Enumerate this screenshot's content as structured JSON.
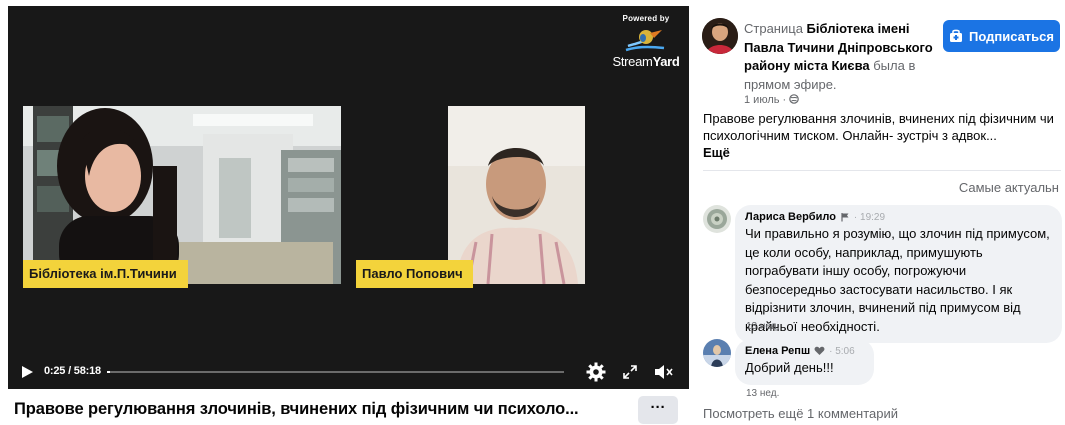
{
  "video": {
    "powered_by": "Powered by",
    "brand_light": "Stream",
    "brand_bold": "Yard",
    "participants": [
      {
        "name": "Бібліотека ім.П.Тичини"
      },
      {
        "name": "Павло Попович"
      }
    ],
    "time": "0:25 / 58:18",
    "progress_fraction": 0.007,
    "title": "Правове регулювання злочинів, вчинених під фізичним чи психоло...",
    "more_label": "···"
  },
  "post": {
    "prefix": "Страница ",
    "page_name": "Бібліотека імені Павла Тичини Дніпровського району міста Києва",
    "suffix": " была в прямом эфире.",
    "date": "1 июль · ",
    "subscribe_label": "Подписаться",
    "text": "Правове регулювання злочинів, вчинених під фізичним чи психологічним тиском. Онлайн- зустріч з адвок...",
    "see_more": "Ещё",
    "sort_label": "Самые актуальн"
  },
  "comments": [
    {
      "author": "Лариса Вербило",
      "time": "· 19:29",
      "text": "Чи правильно я розумію, що злочин під примусом, це коли особу, наприклад, примушують пограбувати іншу особу, погрожуючи безпосередньо застосувати насильство. І як відрізнити злочин, вчинений під примусом від крайньої необхідності.",
      "age": "13 нед."
    },
    {
      "author": "Елена Репш",
      "time": "· 5:06",
      "text": "Добрий день!!!",
      "age": "13 нед."
    }
  ],
  "view_more_comments": "Посмотреть ещё 1 комментарий",
  "colors": {
    "video_bg": "#181818",
    "name_tag": "#f3d33b",
    "subscribe_button": "#1b74e4",
    "bubble": "#f0f2f5"
  }
}
